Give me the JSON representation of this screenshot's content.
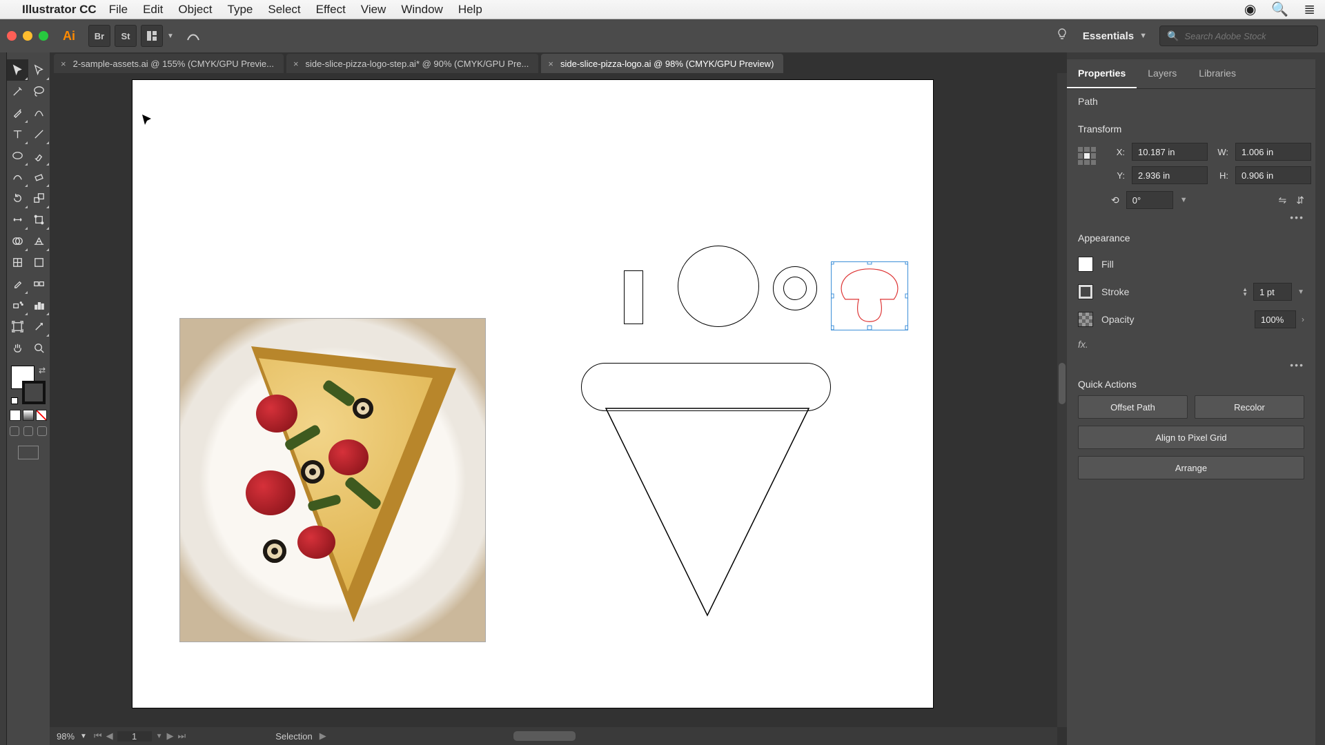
{
  "menubar": {
    "appname": "Illustrator CC",
    "items": [
      "File",
      "Edit",
      "Object",
      "Type",
      "Select",
      "Effect",
      "View",
      "Window",
      "Help"
    ]
  },
  "appbar": {
    "workspace": "Essentials",
    "search_placeholder": "Search Adobe Stock"
  },
  "doc_tabs": [
    {
      "label": "2-sample-assets.ai @ 155% (CMYK/GPU Previe...",
      "active": false
    },
    {
      "label": "side-slice-pizza-logo-step.ai* @ 90% (CMYK/GPU Pre...",
      "active": false
    },
    {
      "label": "side-slice-pizza-logo.ai @ 98% (CMYK/GPU Preview)",
      "active": true
    }
  ],
  "statusbar": {
    "zoom": "98%",
    "page": "1",
    "mode": "Selection"
  },
  "panel": {
    "tabs": [
      "Properties",
      "Layers",
      "Libraries"
    ],
    "object_type": "Path",
    "sections": {
      "transform": "Transform",
      "appearance": "Appearance",
      "quick": "Quick Actions"
    },
    "transform": {
      "x": "10.187 in",
      "y": "2.936 in",
      "w": "1.006 in",
      "h": "0.906 in",
      "rotate": "0°"
    },
    "appearance": {
      "fill_label": "Fill",
      "stroke_label": "Stroke",
      "stroke_value": "1 pt",
      "opacity_label": "Opacity",
      "opacity_value": "100%",
      "fx": "fx."
    },
    "quick_actions": [
      "Offset Path",
      "Recolor",
      "Align to Pixel Grid",
      "Arrange"
    ]
  }
}
